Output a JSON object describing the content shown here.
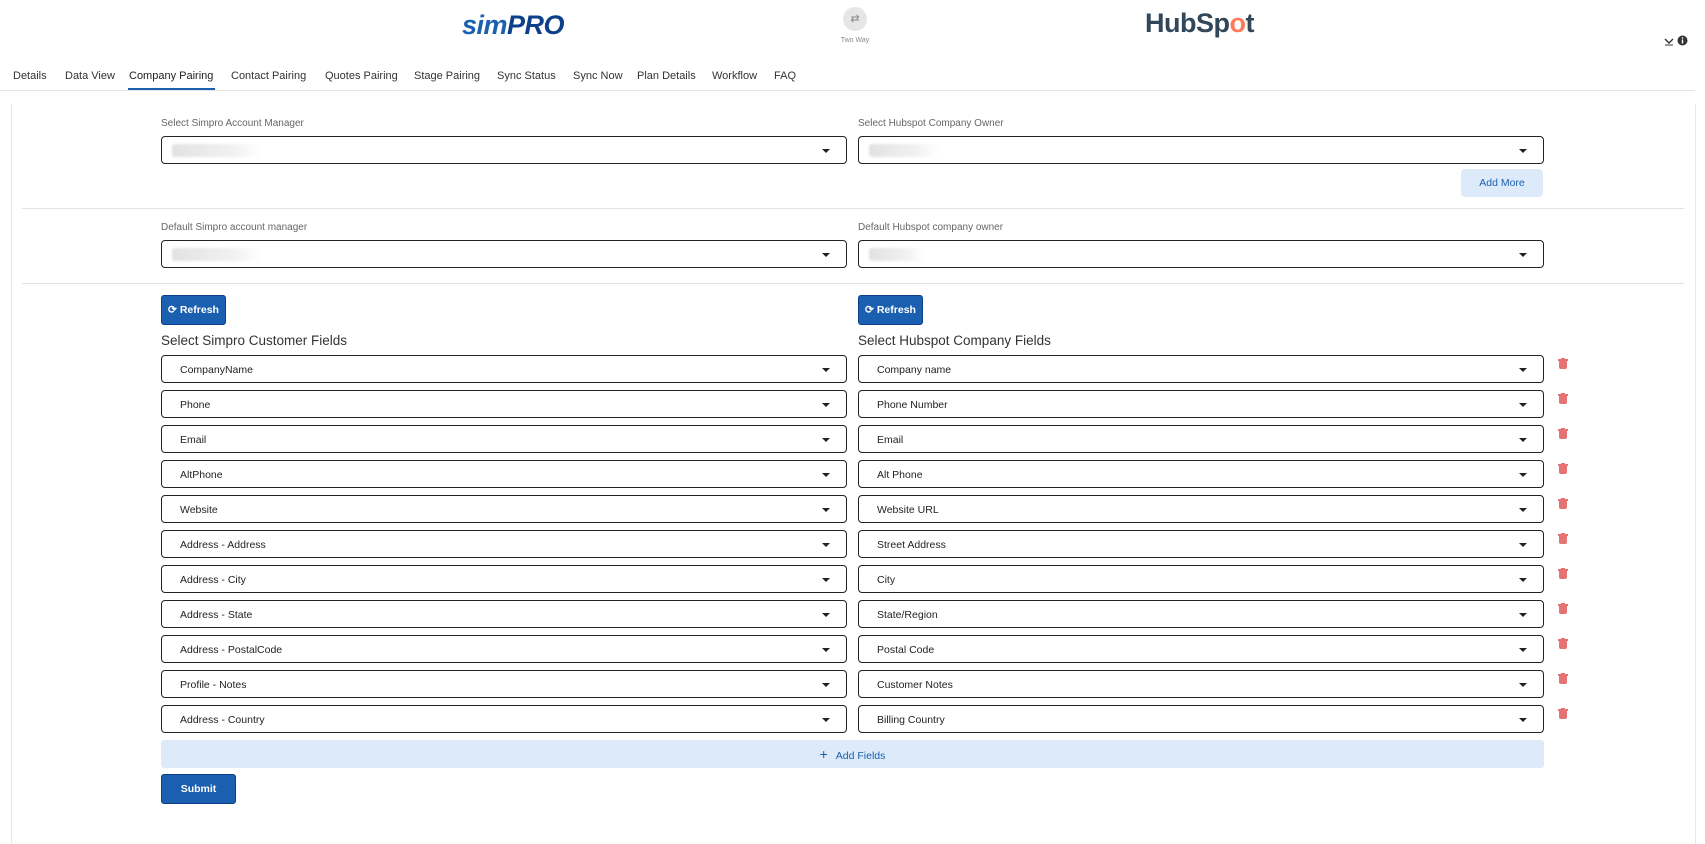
{
  "header": {
    "simpro_logo": {
      "part1": "sim",
      "part2": "PRO"
    },
    "hubspot_logo": {
      "part1": "HubSp",
      "part2": "o",
      "part3": "t"
    },
    "sync_direction_icon": "⇄",
    "sync_direction_label": "Two Way",
    "collapse_icon": "chevron-down-icon",
    "info_icon": "info-icon"
  },
  "tabs": [
    {
      "label": "Details"
    },
    {
      "label": "Data View"
    },
    {
      "label": "Company Pairing",
      "active": true
    },
    {
      "label": "Contact Pairing"
    },
    {
      "label": "Quotes Pairing"
    },
    {
      "label": "Stage Pairing"
    },
    {
      "label": "Sync Status"
    },
    {
      "label": "Sync Now"
    },
    {
      "label": "Plan Details"
    },
    {
      "label": "Workflow"
    },
    {
      "label": "FAQ"
    }
  ],
  "owner_mapping": {
    "simpro_label": "Select Simpro Account Manager",
    "hubspot_label": "Select Hubspot Company Owner",
    "add_more": "Add More"
  },
  "defaults": {
    "simpro_label": "Default Simpro account manager",
    "hubspot_label": "Default Hubspot company owner"
  },
  "fields": {
    "refresh_label": "Refresh",
    "simpro_title": "Select Simpro Customer Fields",
    "hubspot_title": "Select Hubspot Company Fields",
    "rows": [
      {
        "simpro": "CompanyName",
        "hubspot": "Company name"
      },
      {
        "simpro": "Phone",
        "hubspot": "Phone Number"
      },
      {
        "simpro": "Email",
        "hubspot": "Email"
      },
      {
        "simpro": "AltPhone",
        "hubspot": "Alt Phone"
      },
      {
        "simpro": "Website",
        "hubspot": "Website URL"
      },
      {
        "simpro": "Address - Address",
        "hubspot": "Street Address"
      },
      {
        "simpro": "Address - City",
        "hubspot": "City"
      },
      {
        "simpro": "Address - State",
        "hubspot": "State/Region"
      },
      {
        "simpro": "Address - PostalCode",
        "hubspot": "Postal Code"
      },
      {
        "simpro": "Profile - Notes",
        "hubspot": "Customer Notes"
      },
      {
        "simpro": "Address - Country",
        "hubspot": "Billing Country"
      }
    ],
    "add_fields": "Add Fields",
    "submit": "Submit"
  },
  "colors": {
    "primary": "#1b5fb0",
    "accent_light": "#dceaf9",
    "danger": "#e57373",
    "hubspot_orange": "#ff7a59"
  }
}
